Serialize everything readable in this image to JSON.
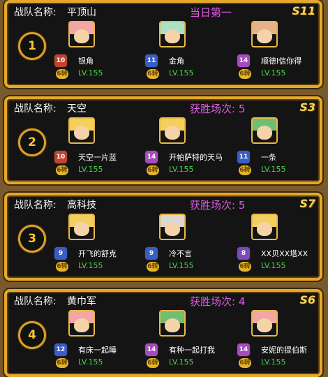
{
  "team_label": "战队名称:",
  "teams": [
    {
      "rank": "1",
      "name": "平顶山",
      "status": "当日第一",
      "season": "S11",
      "members": [
        {
          "name": "银角",
          "level_badge": "10",
          "badge_color": "#c2442f",
          "turn": "6转",
          "lv": "LV.155",
          "hair": "#f2a6a6"
        },
        {
          "name": "金角",
          "level_badge": "11",
          "badge_color": "#3a5cc8",
          "turn": "6转",
          "lv": "LV.155",
          "hair": "#a8e0c8"
        },
        {
          "name": "顺德I信你得",
          "level_badge": "14",
          "badge_color": "#a94ac0",
          "turn": "6转",
          "lv": "LV.155",
          "hair": "#e7b28a"
        }
      ]
    },
    {
      "rank": "2",
      "name": "天空",
      "status": "获胜场次: 5",
      "season": "S3",
      "members": [
        {
          "name": "天空一片蓝",
          "level_badge": "10",
          "badge_color": "#c2442f",
          "turn": "6转",
          "lv": "LV.155",
          "hair": "#f4cf5a"
        },
        {
          "name": "开帕萨特的天马",
          "level_badge": "14",
          "badge_color": "#a94ac0",
          "turn": "6转",
          "lv": "LV.155",
          "hair": "#f4cf5a"
        },
        {
          "name": "一条",
          "level_badge": "11",
          "badge_color": "#3a5cc8",
          "turn": "6转",
          "lv": "LV.155",
          "hair": "#6fbf72"
        }
      ]
    },
    {
      "rank": "3",
      "name": "高科技",
      "status": "获胜场次: 5",
      "season": "S7",
      "members": [
        {
          "name": "开飞的舒克",
          "level_badge": "9",
          "badge_color": "#3a5cc8",
          "turn": "6转",
          "lv": "LV.155",
          "hair": "#f2d060"
        },
        {
          "name": "冷不言",
          "level_badge": "9",
          "badge_color": "#3a5cc8",
          "turn": "6转",
          "lv": "LV.155",
          "hair": "#d8d8d8"
        },
        {
          "name": "XX贝XX塔XX",
          "level_badge": "8",
          "badge_color": "#7a4ab8",
          "turn": "6转",
          "lv": "LV.155",
          "hair": "#f2d060"
        }
      ]
    },
    {
      "rank": "4",
      "name": "黄巾军",
      "status": "获胜场次: 4",
      "season": "S6",
      "members": [
        {
          "name": "有床一起睡",
          "level_badge": "12",
          "badge_color": "#3a5cc8",
          "turn": "6转",
          "lv": "LV.155",
          "hair": "#f2a6a6"
        },
        {
          "name": "有种一起打我",
          "level_badge": "14",
          "badge_color": "#a94ac0",
          "turn": "6转",
          "lv": "LV.155",
          "hair": "#6fbf72"
        },
        {
          "name": "安妮的提伯斯",
          "level_badge": "14",
          "badge_color": "#a94ac0",
          "turn": "6转",
          "lv": "LV.155",
          "hair": "#f2a6a6"
        }
      ]
    }
  ],
  "colors": {
    "frame": "#e3a92a",
    "status_text": "#e259e6",
    "level_text": "#49d64b",
    "season_text": "#f6d45a"
  }
}
